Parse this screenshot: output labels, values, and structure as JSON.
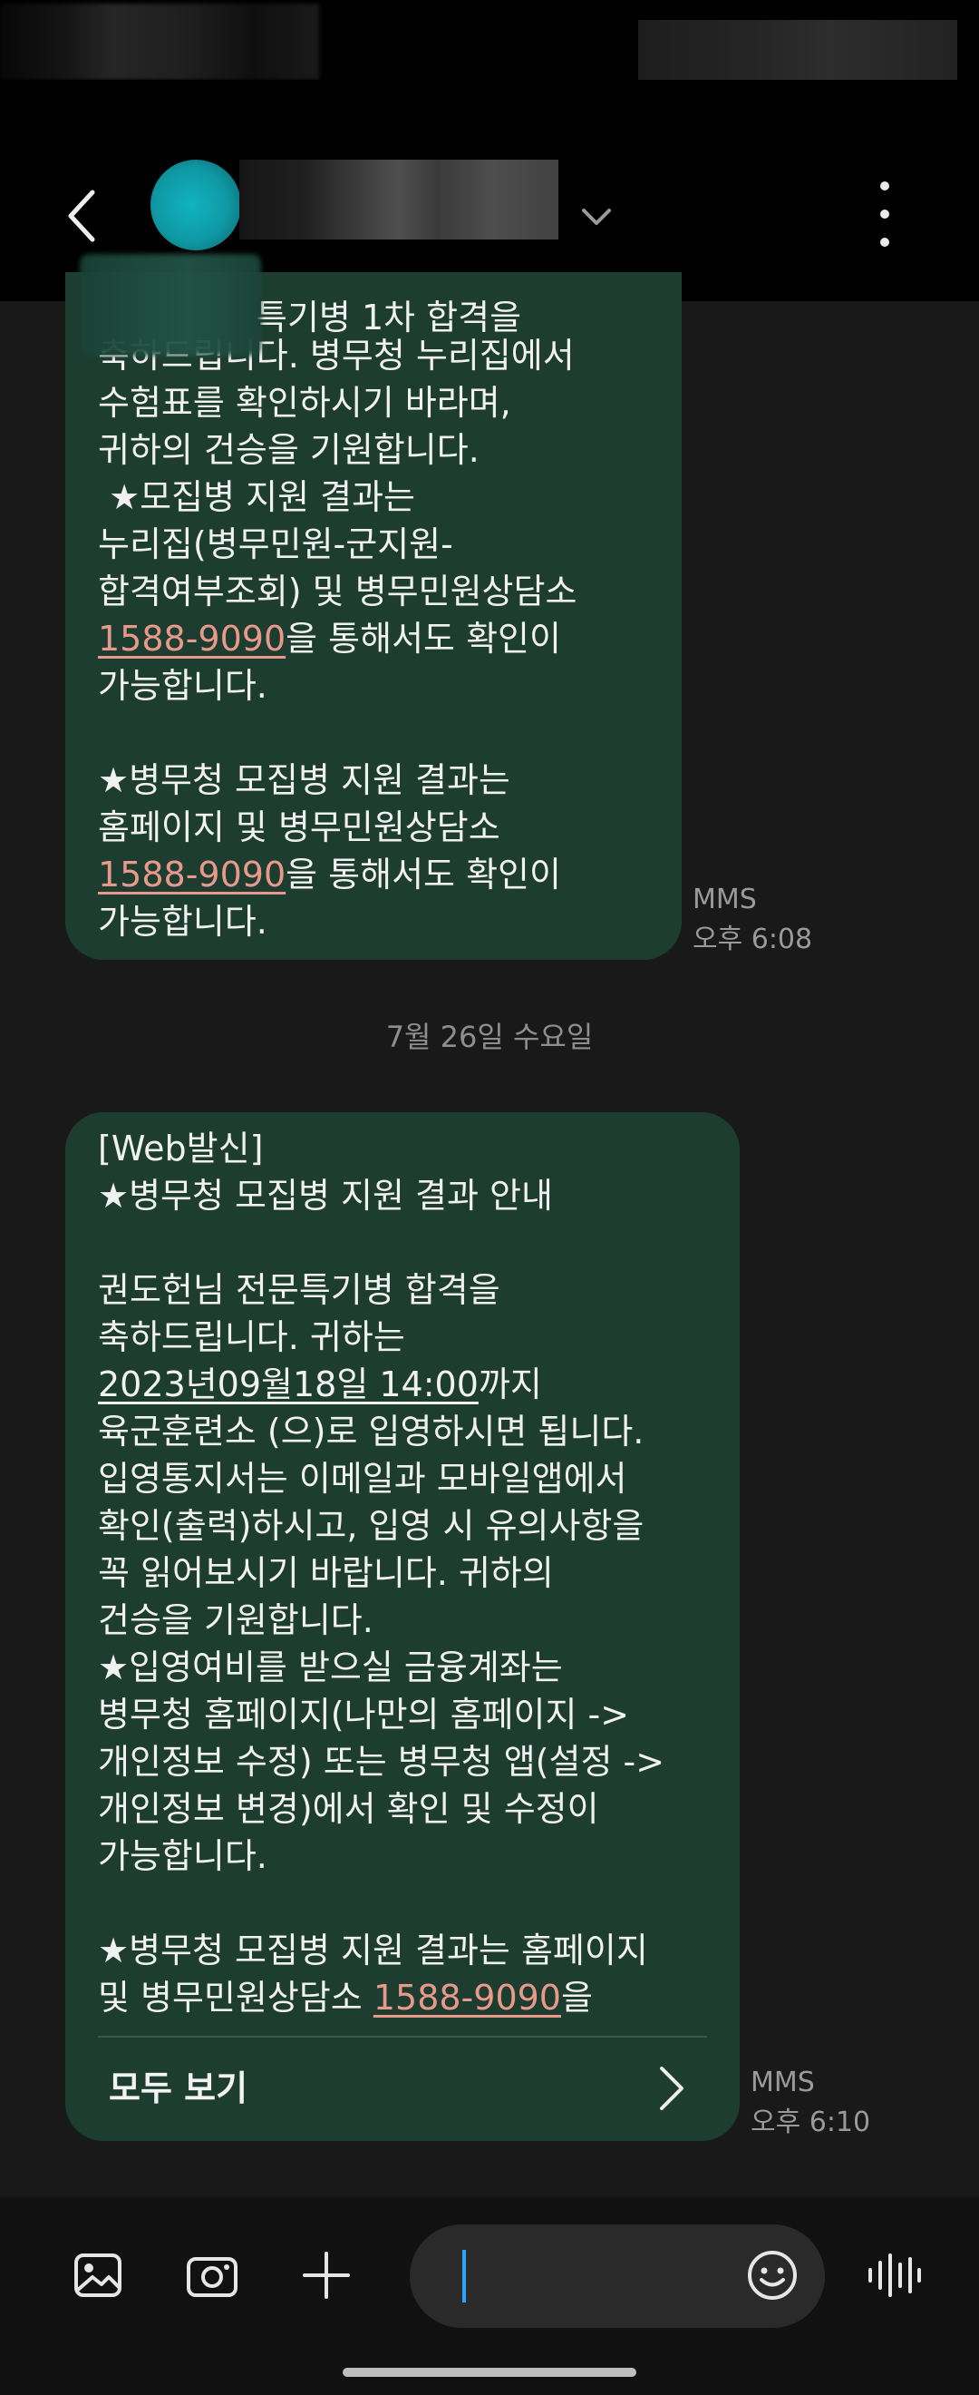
{
  "header": {
    "back_icon": "back-chevron-icon",
    "more_icon": "more-vertical-icon"
  },
  "thread": {
    "messages": [
      {
        "lines": [
          "특기병 1차 합격을",
          "축하드립니다. 병무청 누리집에서",
          "수험표를 확인하시기 바라며,",
          "귀하의 건승을 기원합니다.",
          " ★모집병 지원 결과는",
          "누리집(병무민원-군지원-",
          "합격여부조회) 및 병무민원상담소",
          "",
          "가능합니다.",
          "",
          "★병무청 모집병 지원 결과는",
          "홈페이지 및 병무민원상담소",
          "",
          "가능합니다."
        ],
        "link_line_1": {
          "link": "1588-9090",
          "rest": "을 통해서도 확인이"
        },
        "link_line_2": {
          "link": "1588-9090",
          "rest": "을 통해서도 확인이"
        },
        "type": "MMS",
        "time": "오후 6:08"
      },
      {
        "date_separator": "7월 26일 수요일"
      },
      {
        "lines": [
          "[Web발신]",
          "★병무청 모집병 지원 결과 안내",
          "",
          "권도헌님 전문특기병 합격을",
          "축하드립니다. 귀하는",
          "",
          "육군훈련소 (으)로 입영하시면 됩니다.",
          "입영통지서는 이메일과 모바일앱에서",
          "확인(출력)하시고, 입영 시 유의사항을",
          "꼭 읽어보시기 바랍니다. 귀하의",
          "건승을 기원합니다.",
          "★입영여비를 받으실 금융계좌는",
          "병무청 홈페이지(나만의 홈페이지 ->",
          "개인정보 수정) 또는 병무청 앱(설정 ->",
          "개인정보 변경)에서 확인 및 수정이",
          "가능합니다.",
          "",
          "★병무청 모집병 지원 결과는 홈페이지",
          ""
        ],
        "date_line": {
          "date": "2023년09월18일 14:00",
          "rest": "까지"
        },
        "last_line": {
          "prefix": "및 병무민원상담소 ",
          "link": "1588-9090",
          "rest": "을"
        },
        "view_all": "모두 보기",
        "type": "MMS",
        "time": "오후 6:10"
      }
    ]
  },
  "input_bar": {
    "gallery_icon": "image-icon",
    "camera_icon": "camera-icon",
    "add_icon": "plus-icon",
    "emoji_icon": "emoji-icon",
    "voice_icon": "voice-wave-icon",
    "text_value": ""
  },
  "colors": {
    "background": "#191919",
    "bubble": "#1d3d30",
    "link": "#e8998a",
    "cursor": "#2aa3ff"
  }
}
